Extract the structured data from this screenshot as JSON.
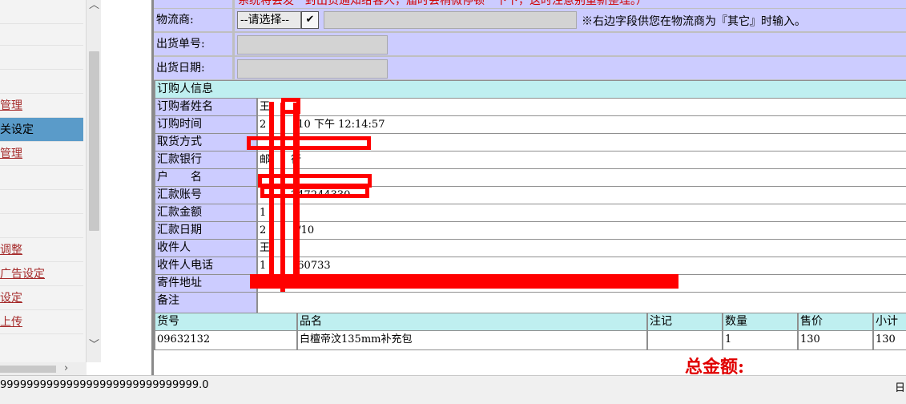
{
  "sidebar": {
    "items": [
      {
        "label": "管理",
        "link": true
      },
      {
        "label": "关设定",
        "link": false,
        "active": true
      },
      {
        "label": "管理",
        "link": true
      },
      {
        "label": "调整",
        "link": true
      },
      {
        "label": "广告设定",
        "link": true
      },
      {
        "label": "设定",
        "link": true
      },
      {
        "label": "上传",
        "link": true
      }
    ]
  },
  "shipping": {
    "top_note": "系统将会发一封出货通知给客人，届时会稍微停顿一下下，这时注意别重新整理。）",
    "carrier_label": "物流商:",
    "carrier_select": "--请选择--",
    "carrier_hint": "※右边字段供您在物流商为『其它』时输入。",
    "ship_no_label": "出货单号:",
    "ship_date_label": "出货日期:"
  },
  "order_info": {
    "section_title": "订购人信息",
    "rows": [
      {
        "key": "订购者姓名",
        "value": "王"
      },
      {
        "key": "订购时间",
        "value": "2　　　10 下午 12:14:57"
      },
      {
        "key": "取货方式",
        "value": ""
      },
      {
        "key": "汇款银行",
        "value": "邮　　行"
      },
      {
        "key": "户　　名",
        "value": ""
      },
      {
        "key": "汇款账号",
        "value": "　　　247244330"
      },
      {
        "key": "汇款金额",
        "value": "1"
      },
      {
        "key": "汇款日期",
        "value": "2　　　/10"
      },
      {
        "key": "收件人",
        "value": "王"
      },
      {
        "key": "收件人电话",
        "value": "1　　　60733"
      },
      {
        "key": "寄件地址",
        "value": ""
      },
      {
        "key": "备注",
        "value": ""
      }
    ]
  },
  "items": {
    "headers": [
      "货号",
      "品名",
      "注记",
      "数量",
      "售价",
      "小计"
    ],
    "rows": [
      [
        "09632132",
        "白檀帝汶135mm补充包",
        "",
        "1",
        "130",
        "130"
      ]
    ]
  },
  "total_label": "总金额:",
  "statusbar": {
    "text": "999999999999999999999999999999.0",
    "right": "日"
  },
  "colors": {
    "label_bg": "#ccccff",
    "header_bg": "#bfeff0",
    "redaction": "#ff0000",
    "total_text": "#e00000"
  }
}
